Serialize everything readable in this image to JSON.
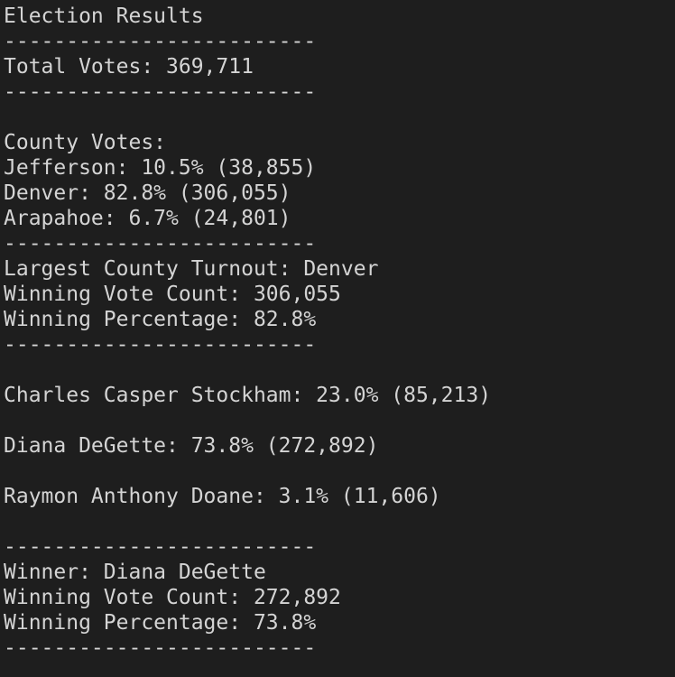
{
  "terminal": {
    "lines": [
      "Election Results",
      "-------------------------",
      "Total Votes: 369,711",
      "-------------------------",
      "",
      "County Votes:",
      "Jefferson: 10.5% (38,855)",
      "Denver: 82.8% (306,055)",
      "Arapahoe: 6.7% (24,801)",
      "-------------------------",
      "Largest County Turnout: Denver",
      "Winning Vote Count: 306,055",
      "Winning Percentage: 82.8%",
      "-------------------------",
      "",
      "Charles Casper Stockham: 23.0% (85,213)",
      "",
      "Diana DeGette: 73.8% (272,892)",
      "",
      "Raymon Anthony Doane: 3.1% (11,606)",
      "",
      "-------------------------",
      "Winner: Diana DeGette",
      "Winning Vote Count: 272,892",
      "Winning Percentage: 73.8%",
      "-------------------------"
    ]
  },
  "colors": {
    "background": "#1e1e1e",
    "text": "#d4d4d4"
  }
}
